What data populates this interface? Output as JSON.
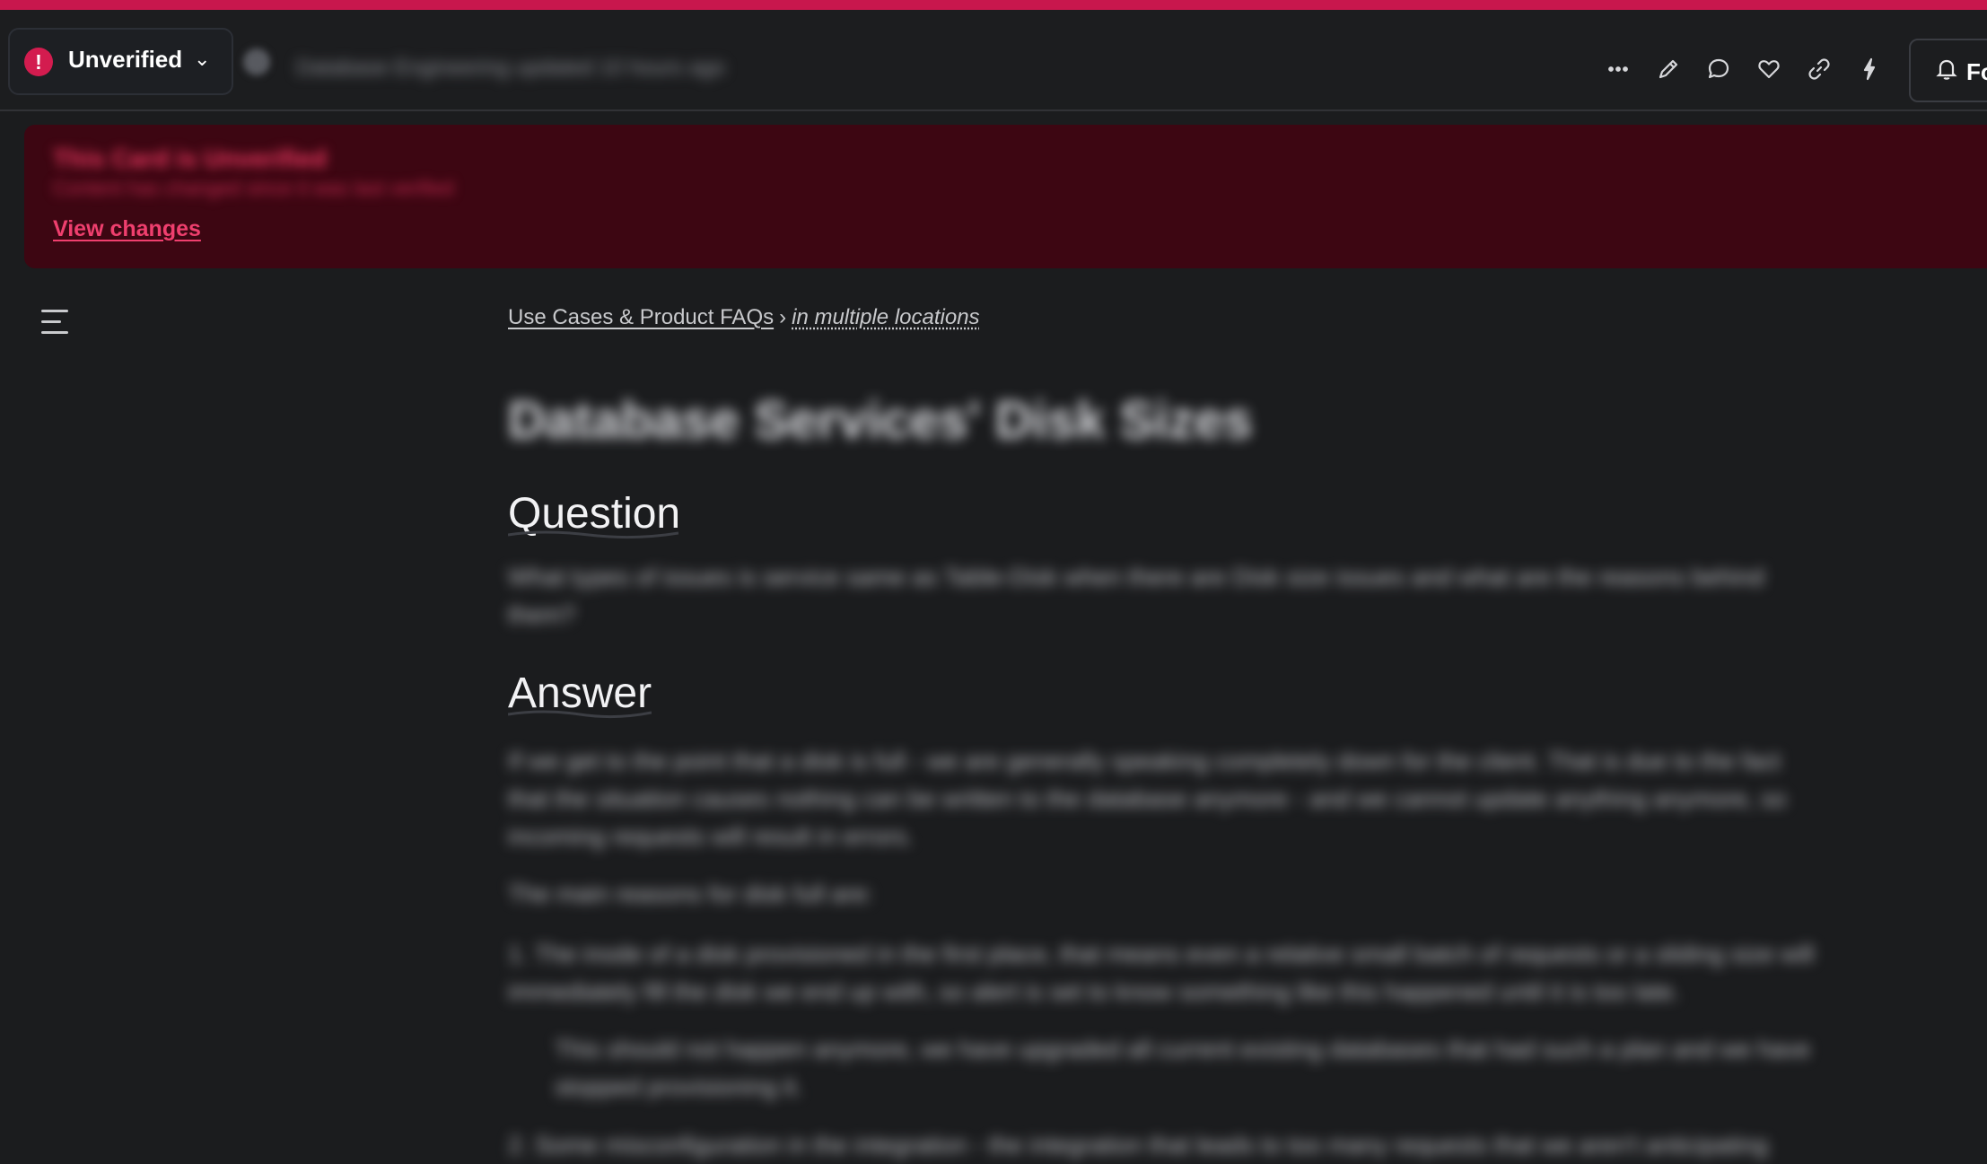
{
  "topbar": {
    "status_label": "Unverified",
    "status_icon": "alert-icon",
    "meta_text": "Database Engineering updated 10 hours ago",
    "toolbar_icons": [
      "more-icon",
      "edit-icon",
      "comment-icon",
      "heart-icon",
      "link-icon",
      "lightning-icon"
    ],
    "follow_label": "Fo"
  },
  "banner": {
    "title": "This Card is Unverified",
    "subtitle": "Content has changed since it was last verified",
    "link_label": "View changes"
  },
  "breadcrumb": {
    "collection": "Use Cases & Product FAQs",
    "separator": "›",
    "location": "in multiple locations"
  },
  "card": {
    "title": "Database Services' Disk Sizes",
    "question_heading": "Question",
    "question_text": "What types of issues is service same as Table-Disk when there are Disk size issues and what are the reasons behind them?",
    "answer_heading": "Answer",
    "answer_paragraphs": [
      "If we get to the point that a disk is full - we are generally speaking completely down for the client. That is due to the fact that the situation causes nothing can be written to the database anymore - and we cannot update anything anymore, so incoming requests will result in errors.",
      "The main reasons for disk full are:",
      "1. The inode of a disk provisioned in the first place, that means even a relative small batch of requests or a sliding size will immediately fill the disk we end up with, so alert is set to know something like this happened until it is too late.",
      "This should not happen anymore, we have upgraded all current existing databases that had such a plan and we have stopped provisioning it.",
      "2. Some misconfiguration in the integration - the integration that leads to too many requests that we aren't anticipating"
    ]
  },
  "colors": {
    "accent": "#c8174d",
    "banner_bg": "#3d0612",
    "link": "#ef3f6e",
    "page_bg": "#1b1c1e"
  }
}
